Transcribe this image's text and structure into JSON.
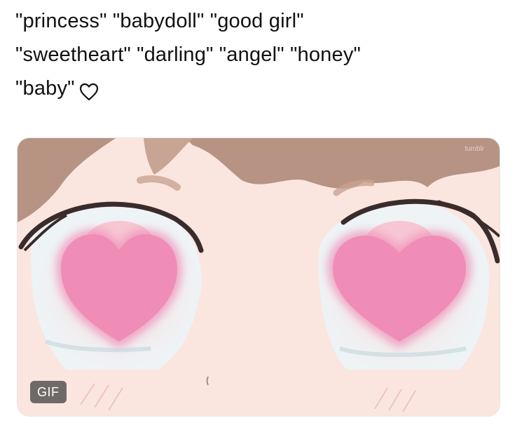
{
  "tweet": {
    "lines": [
      "\"princess\"  \"babydoll\"  \"good  girl\"",
      "\"sweetheart\"  \"darling\"  \"angel\"  \"honey\"",
      "\"baby\""
    ],
    "heart_icon": "heart-outline-icon"
  },
  "media": {
    "badge_label": "GIF",
    "watermark": "tumblr",
    "colors": {
      "skin": "#fbe6df",
      "hair": "#b69383",
      "heart": "#ef8db6",
      "eye_white": "#eef3f6",
      "lash": "#3a2c2a"
    }
  }
}
